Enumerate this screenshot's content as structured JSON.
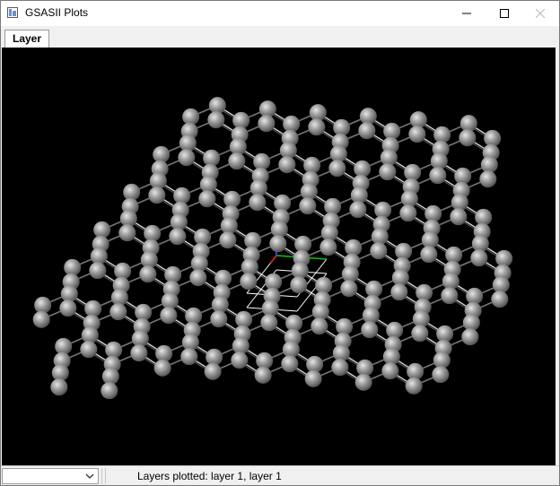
{
  "window": {
    "title": "GSASII Plots"
  },
  "tabs": [
    {
      "label": "Layer",
      "active": true
    }
  ],
  "plot": {
    "background": "#000000",
    "atom_color": "#8f8f8f",
    "bond_color": "#d8d8d8",
    "cell_color": "#ffffff",
    "axis_a_color": "#00c800",
    "axis_b_color": "#c81e1e",
    "axis_c_color": "#3c3cff"
  },
  "status": {
    "selected_value": "",
    "text": "Layers plotted: layer 1, layer 1"
  }
}
